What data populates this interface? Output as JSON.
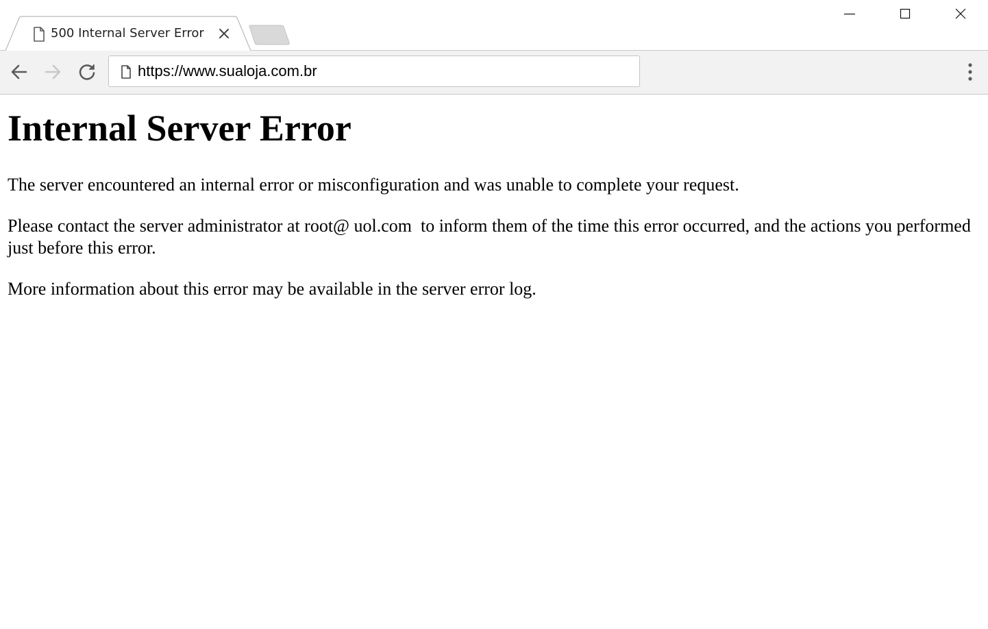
{
  "browser": {
    "tab": {
      "title": "500 Internal Server Error",
      "favicon": "document-icon",
      "close": "close-icon"
    },
    "window_controls": [
      "minimize-icon",
      "maximize-icon",
      "close-icon"
    ],
    "toolbar": {
      "back": "back-arrow-icon",
      "forward": "forward-arrow-icon",
      "reload": "reload-icon",
      "menu": "kebab-menu-icon"
    },
    "address_bar": {
      "url": "https://www.sualoja.com.br",
      "page_icon": "document-icon"
    }
  },
  "page": {
    "heading": "Internal Server Error",
    "paragraphs": [
      "The server encountered an internal error or misconfiguration and was unable to complete your request.",
      "Please contact the server administrator at root@ uol.com  to inform them of the time this error occurred, and the actions you performed just before this error.",
      "More information about this error may be available in the server error log."
    ]
  },
  "colors": {
    "toolbar_bg": "#f2f2f2",
    "border": "#c6c6c6",
    "icon": "#5a5a5a",
    "icon_disabled": "#c8c8c8",
    "text": "#000000"
  }
}
